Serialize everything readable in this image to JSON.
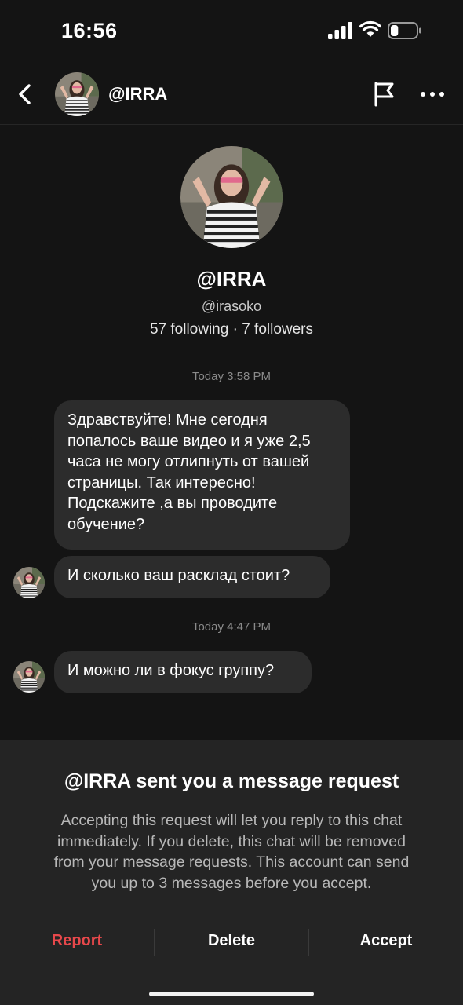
{
  "status_bar": {
    "time": "16:56",
    "battery_level": 0.3
  },
  "nav": {
    "title": "@IRRA"
  },
  "profile": {
    "name": "@IRRA",
    "handle": "@irasoko",
    "stats": "57 following · 7 followers"
  },
  "messages": {
    "timestamp_1": "Today 3:58 PM",
    "msg_1_lines": [
      "Здравствуйте! Мне сегодня",
      "попалось ваше видео и я уже 2,5",
      "часа не могу отлипнуть от вашей",
      "страницы. Так интересно!",
      "Подскажите ,а вы проводите",
      "обучение?"
    ],
    "msg_2": "И сколько ваш расклад стоит?",
    "timestamp_2": "Today 4:47 PM",
    "msg_3": "И можно ли в фокус группу?"
  },
  "request": {
    "title": "@IRRA sent you a message request",
    "body_lines": [
      "Accepting this request will let you reply to this chat",
      "immediately. If you delete, this chat will be removed",
      "from your message requests. This account can send",
      "you up to 3 messages before you accept."
    ],
    "report_label": "Report",
    "delete_label": "Delete",
    "accept_label": "Accept"
  },
  "colors": {
    "report": "#e8484b",
    "bubble": "#2c2c2c",
    "background": "#141414",
    "panel": "#242424"
  }
}
